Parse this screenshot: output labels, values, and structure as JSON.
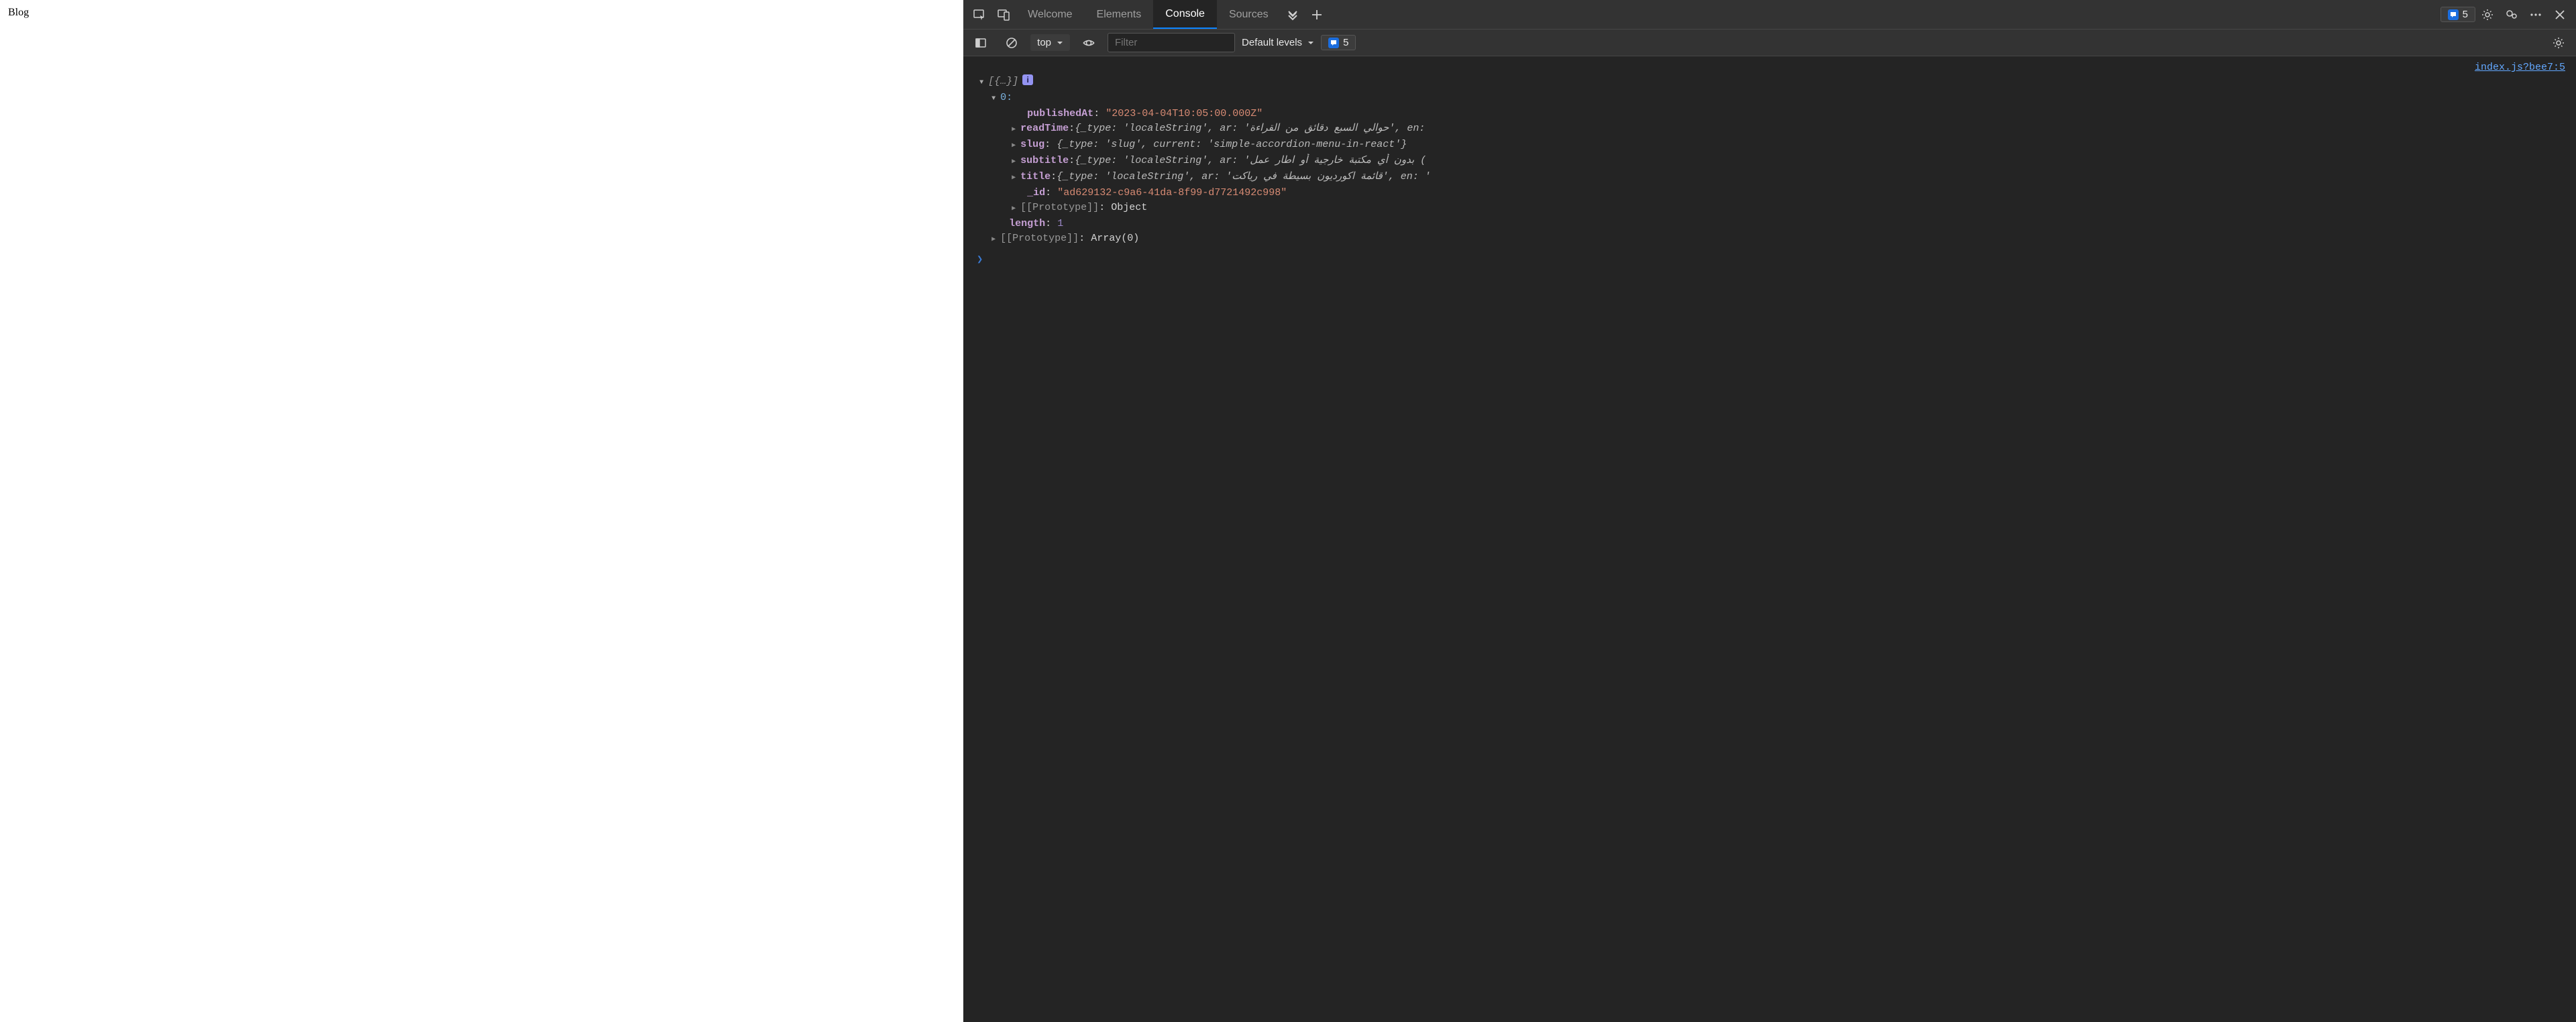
{
  "page": {
    "heading": "Blog"
  },
  "tabs": {
    "welcome": "Welcome",
    "elements": "Elements",
    "console": "Console",
    "sources": "Sources"
  },
  "badges": {
    "issue_count_top": "5",
    "issue_count_toolbar": "5"
  },
  "toolbar": {
    "context": "top",
    "filter_placeholder": "Filter",
    "levels": "Default levels"
  },
  "source_link": "index.js?bee7:5",
  "log": {
    "array_summary": "[{…}]",
    "info_glyph": "i",
    "index0": "0:",
    "publishedAt_key": "publishedAt",
    "publishedAt_val": "\"2023-04-04T10:05:00.000Z\"",
    "readTime_key": "readTime",
    "readTime_val": "{_type: 'localeString', ar: 'حوالي السبع دقائق من القراءة', en:",
    "slug_key": "slug",
    "slug_val": "{_type: 'slug', current: 'simple-accordion-menu-in-react'}",
    "subtitle_key": "subtitle",
    "subtitle_val": "{_type: 'localeString', ar: 'بدون أي مكتبة خارجية أو اطار عمل (",
    "title_key": "title",
    "title_val": "{_type: 'localeString', ar: 'قائمة اكورديون بسيطة في رياكت', en: '",
    "id_key": "_id",
    "id_val": "\"ad629132-c9a6-41da-8f99-d7721492c998\"",
    "proto0": "[[Prototype]]",
    "proto0_val": "Object",
    "length_key": "length",
    "length_val": "1",
    "proto1": "[[Prototype]]",
    "proto1_val": "Array(0)"
  }
}
